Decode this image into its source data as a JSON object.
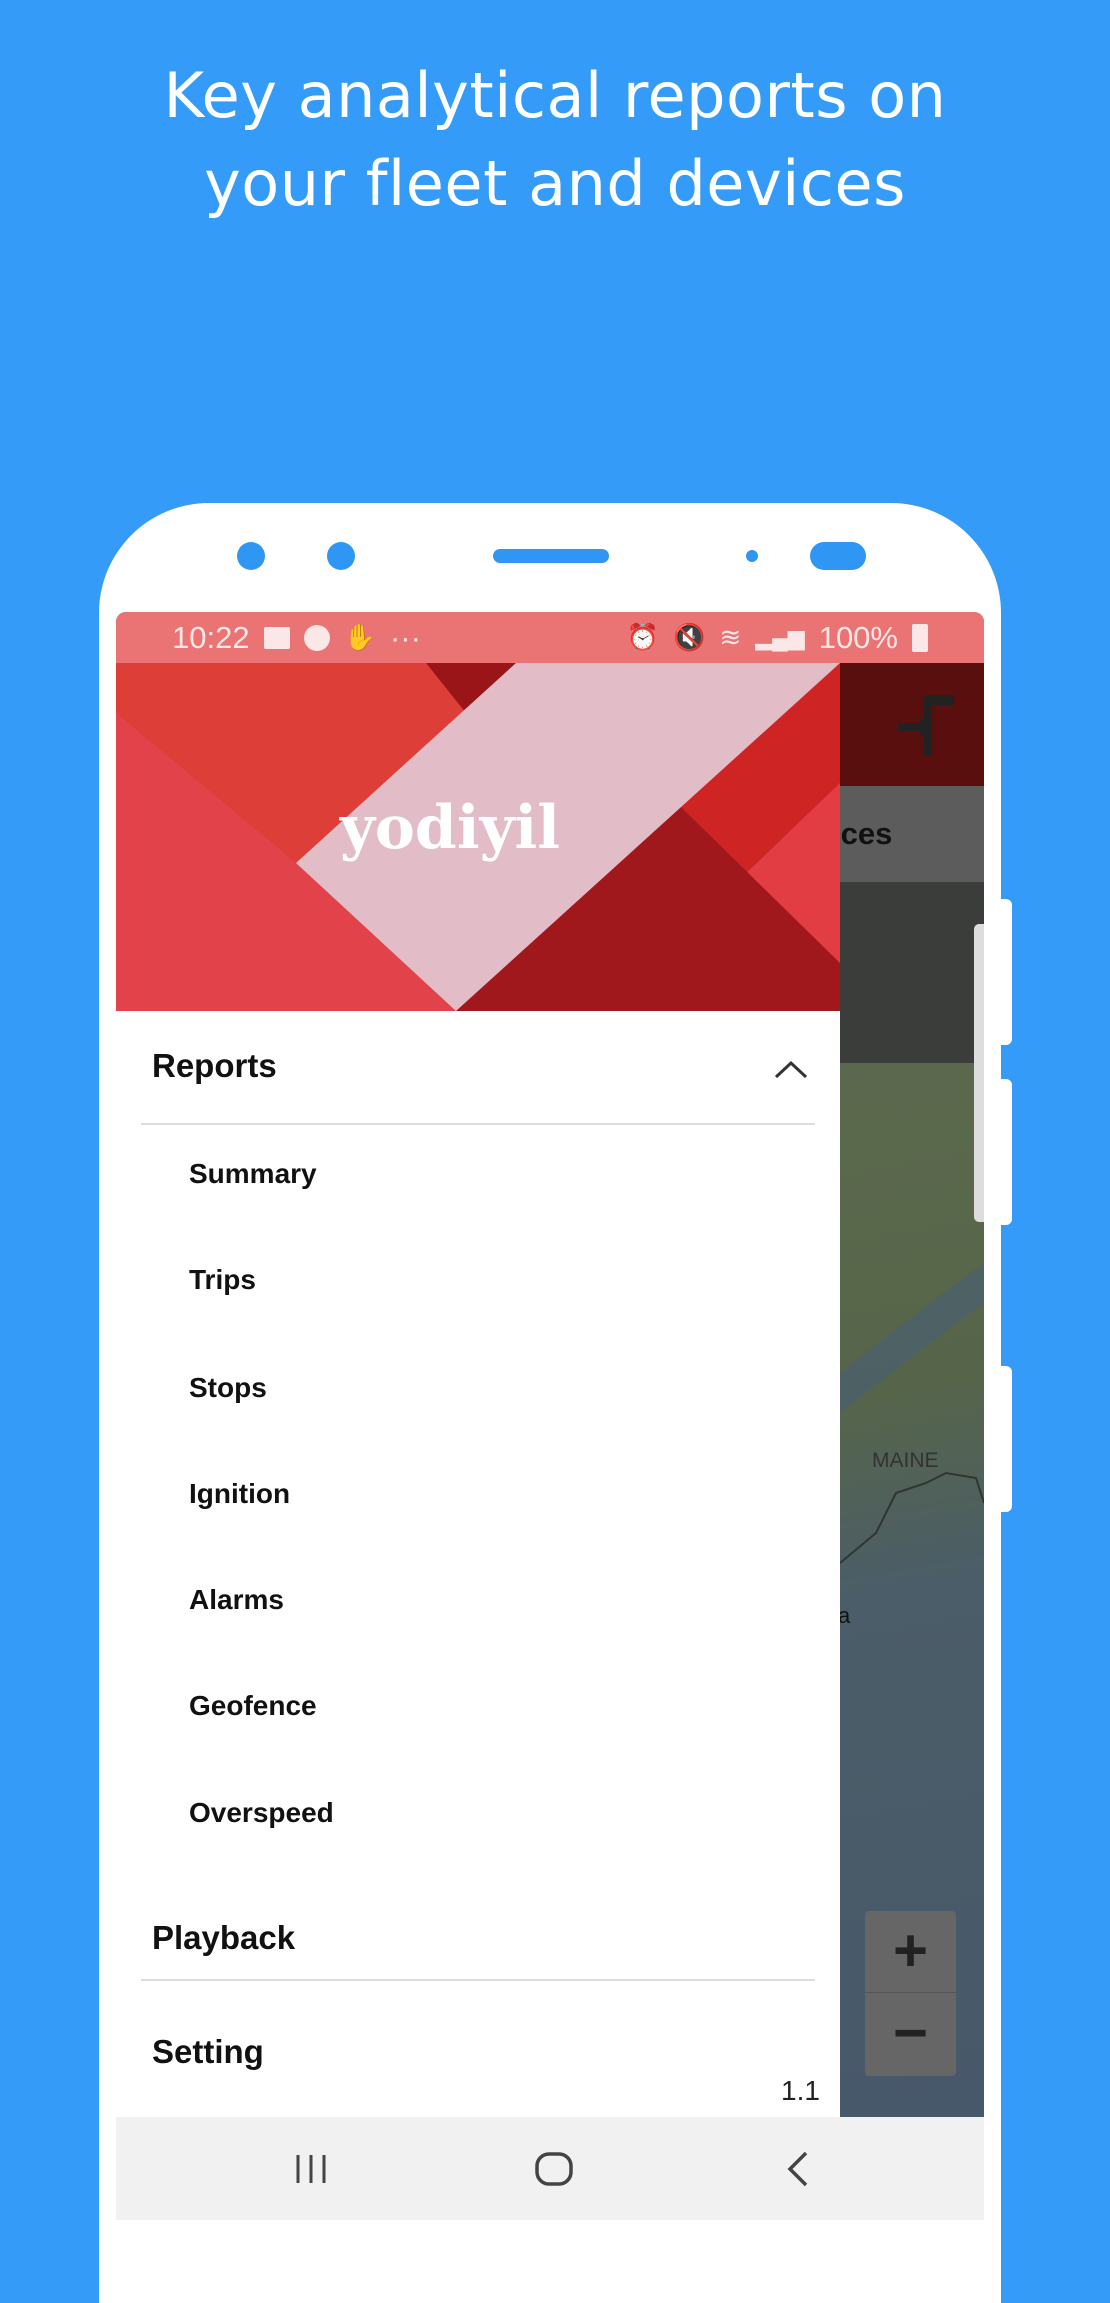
{
  "headline": {
    "line1": "Key analytical reports on",
    "line2": "your fleet and devices"
  },
  "status_bar": {
    "time": "10:22",
    "battery": "100%",
    "icons_left": [
      "image-icon",
      "app-icon",
      "notification-icon",
      "more-icon"
    ],
    "icons_right": [
      "alarm-icon",
      "mute-icon",
      "wifi-icon",
      "signal-icon",
      "battery-icon"
    ]
  },
  "drawer": {
    "brand": "yodiyil",
    "reports_label": "Reports",
    "report_items": [
      "Summary",
      "Trips",
      "Stops",
      "Ignition",
      "Alarms",
      "Geofence",
      "Overspeed"
    ],
    "playback_label": "Playback",
    "setting_label": "Setting",
    "version": "1.1"
  },
  "background_app": {
    "tab_label_partial": "ices",
    "map_label": "MAINE",
    "map_label_partial": "a",
    "zoom_in": "+",
    "zoom_out": "−"
  },
  "colors": {
    "background": "#349cf8",
    "status_bar": "#ea7373",
    "app_bar": "#5a0f0f"
  }
}
